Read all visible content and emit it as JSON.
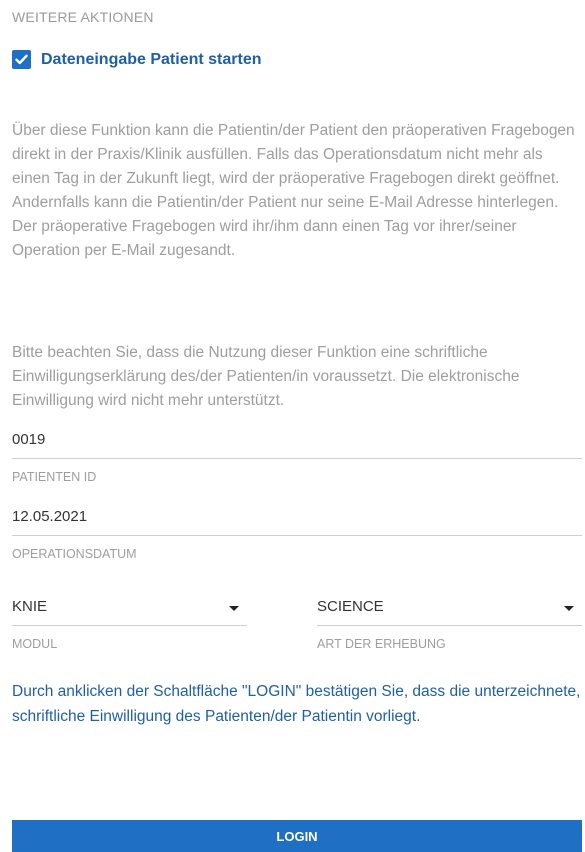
{
  "section": {
    "title": "WEITERE AKTIONEN"
  },
  "checkbox": {
    "label": "Dateneingabe Patient starten",
    "checked": true,
    "icon": "checkmark-icon"
  },
  "info": {
    "paragraph1": "Über diese Funktion kann die Patientin/der Patient den präoperativen Fragebogen direkt in der Praxis/Klinik ausfüllen. Falls das Operationsdatum nicht mehr als einen Tag in der Zukunft liegt, wird der präoperative Fragebogen direkt geöffnet. Andernfalls kann die Patientin/der Patient nur seine E-Mail Adresse hinterlegen. Der präoperative Fragebogen wird ihr/ihm dann einen Tag vor ihrer/seiner Operation per E-Mail zugesandt.",
    "paragraph2": "Bitte beachten Sie, dass die Nutzung dieser Funktion eine schriftliche Einwilligungserklärung des/der Patienten/in voraussetzt. Die elektronische Einwilligung wird nicht mehr unterstützt."
  },
  "fields": {
    "patient_id": {
      "value": "0019",
      "label": "PATIENTEN ID"
    },
    "operation_date": {
      "value": "12.05.2021",
      "label": "OPERATIONSDATUM"
    },
    "modul": {
      "value": "KNIE",
      "label": "MODUL"
    },
    "art": {
      "value": "SCIENCE",
      "label": "ART DER ERHEBUNG"
    }
  },
  "consent": {
    "text": "Durch anklicken der Schaltfläche \"LOGIN\" bestätigen Sie, dass die unterzeichnete, schriftliche Einwilligung des Patienten/der Patientin vorliegt."
  },
  "login": {
    "label": "LOGIN"
  },
  "colors": {
    "accent": "#1f6fc5",
    "link_text": "#1f5fa8",
    "muted_text": "#9e9e9e"
  }
}
